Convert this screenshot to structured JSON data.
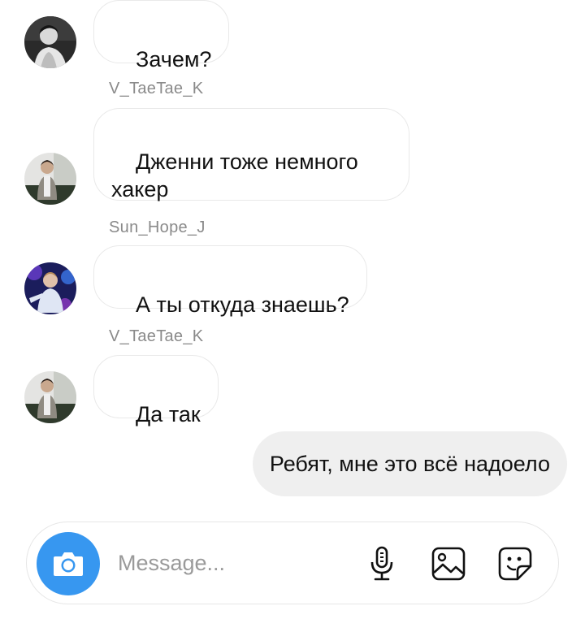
{
  "messages": [
    {
      "text": "Зачем?"
    },
    {
      "sender": "V_TaeTae_K",
      "text": "Дженни тоже немного\nхакер"
    },
    {
      "sender": "Sun_Hope_J",
      "text": "А ты откуда знаешь?"
    },
    {
      "sender": "V_TaeTae_K",
      "text": "Да так"
    }
  ],
  "my_message": {
    "text": "Ребят, мне это всё надоело"
  },
  "composer": {
    "placeholder": "Message...",
    "icons": [
      "camera-icon",
      "microphone-icon",
      "gallery-icon",
      "sticker-icon"
    ]
  },
  "colors": {
    "accent": "#3797f0",
    "incoming_border": "#e9e9e9",
    "outgoing_bg": "#efefef",
    "sender_text": "#8a8a8a"
  }
}
